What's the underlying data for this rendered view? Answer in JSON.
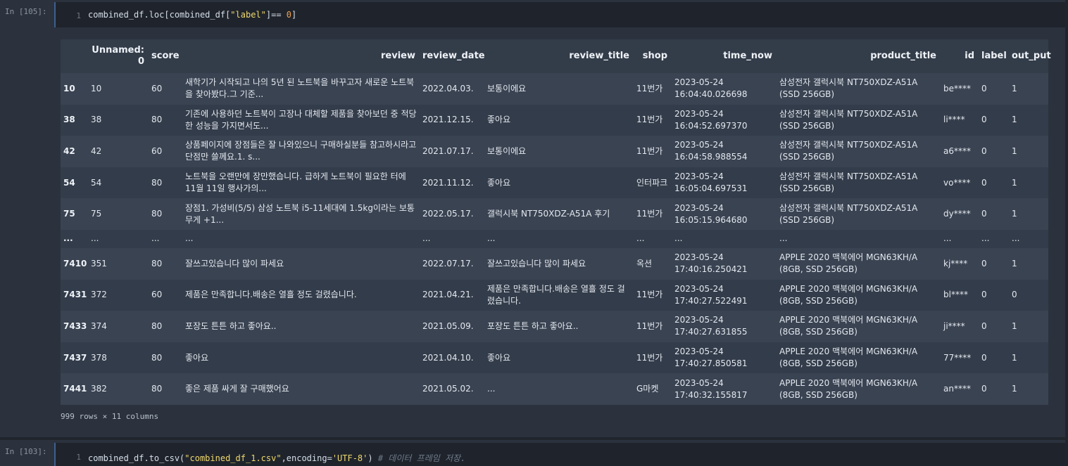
{
  "cell1": {
    "prompt": "In [105]:",
    "line_no": "1",
    "code": {
      "p1": "combined_df.loc[combined_df[",
      "s1": "\"label\"",
      "p2": "]== ",
      "n1": "0",
      "p3": "]"
    }
  },
  "table": {
    "columns": [
      "",
      "Unnamed: 0",
      "score",
      "review",
      "review_date",
      "review_title",
      "shop",
      "time_now",
      "product_title",
      "id",
      "label",
      "out_put"
    ],
    "rows": [
      [
        "10",
        "10",
        "60",
        "새학기가 시작되고 나의 5년 된 노트북을 바꾸고자 새로운 노트북을 찾아봤다.그 기준...",
        "2022.04.03.",
        "보통이에요",
        "11번가",
        "2023-05-24 16:04:40.026698",
        "삼성전자 갤럭시북 NT750XDZ-A51A (SSD 256GB)",
        "be****",
        "0",
        "1"
      ],
      [
        "38",
        "38",
        "80",
        "기존에 사용하던 노트북이 고장나 대체할 제품을 찾아보던 중 적당한 성능을 가지면서도...",
        "2021.12.15.",
        "좋아요",
        "11번가",
        "2023-05-24 16:04:52.697370",
        "삼성전자 갤럭시북 NT750XDZ-A51A (SSD 256GB)",
        "li****",
        "0",
        "1"
      ],
      [
        "42",
        "42",
        "60",
        "상품페이지에 장점들은 잘 나와있으니 구매하실분들 참고하시라고 단점만 쓸께요.1. s...",
        "2021.07.17.",
        "보통이에요",
        "11번가",
        "2023-05-24 16:04:58.988554",
        "삼성전자 갤럭시북 NT750XDZ-A51A (SSD 256GB)",
        "a6****",
        "0",
        "1"
      ],
      [
        "54",
        "54",
        "80",
        "노트북을 오랜만에 장만했습니다. 급하게 노트북이 필요한 터에 11월 11일 행사가의...",
        "2021.11.12.",
        "좋아요",
        "인터파크",
        "2023-05-24 16:05:04.697531",
        "삼성전자 갤럭시북 NT750XDZ-A51A (SSD 256GB)",
        "vo****",
        "0",
        "1"
      ],
      [
        "75",
        "75",
        "80",
        "장점1. 가성비(5/5) 삼성 노트북 i5-11세대에 1.5kg이라는 보통무게 +1...",
        "2022.05.17.",
        "갤럭시북 NT750XDZ-A51A 후기",
        "11번가",
        "2023-05-24 16:05:15.964680",
        "삼성전자 갤럭시북 NT750XDZ-A51A (SSD 256GB)",
        "dy****",
        "0",
        "1"
      ],
      [
        "...",
        "...",
        "...",
        "...",
        "...",
        "...",
        "...",
        "...",
        "...",
        "...",
        "...",
        "..."
      ],
      [
        "7410",
        "351",
        "80",
        "잘쓰고있습니다 많이 파세요",
        "2022.07.17.",
        "잘쓰고있습니다 많이 파세요",
        "옥션",
        "2023-05-24 17:40:16.250421",
        "APPLE 2020 맥북에어 MGN63KH/A (8GB, SSD 256GB)",
        "kj****",
        "0",
        "1"
      ],
      [
        "7431",
        "372",
        "60",
        "제품은 만족합니다.배송은 열흘 정도 걸렸습니다.",
        "2021.04.21.",
        "제품은 만족합니다.배송은 열흘 정도 걸렸습니다.",
        "11번가",
        "2023-05-24 17:40:27.522491",
        "APPLE 2020 맥북에어 MGN63KH/A (8GB, SSD 256GB)",
        "bl****",
        "0",
        "0"
      ],
      [
        "7433",
        "374",
        "80",
        "포장도 튼튼 하고 좋아요..",
        "2021.05.09.",
        "포장도 튼튼 하고 좋아요..",
        "11번가",
        "2023-05-24 17:40:27.631855",
        "APPLE 2020 맥북에어 MGN63KH/A (8GB, SSD 256GB)",
        "ji****",
        "0",
        "1"
      ],
      [
        "7437",
        "378",
        "80",
        "좋아요",
        "2021.04.10.",
        "좋아요",
        "11번가",
        "2023-05-24 17:40:27.850581",
        "APPLE 2020 맥북에어 MGN63KH/A (8GB, SSD 256GB)",
        "77****",
        "0",
        "1"
      ],
      [
        "7441",
        "382",
        "80",
        "좋은 제품 싸게 잘 구매했어요",
        "2021.05.02.",
        "...",
        "G마켓",
        "2023-05-24 17:40:32.155817",
        "APPLE 2020 맥북에어 MGN63KH/A (8GB, SSD 256GB)",
        "an****",
        "0",
        "1"
      ]
    ],
    "summary": "999 rows × 11 columns"
  },
  "cell2": {
    "prompt": "In [103]:",
    "line_no": "1",
    "code": {
      "p1": "combined_df.to_csv(",
      "s1": "\"combined_df_1.csv\"",
      "p2": ",encoding=",
      "s2": "'UTF-8'",
      "p3": ") ",
      "c1": "# 데이터 프레임 저장."
    }
  },
  "colors": {
    "background": "#2b323e",
    "input_bg": "#1f242c",
    "string": "#f0d86d",
    "number": "#f0a050",
    "comment": "#6f7a8a",
    "row_even": "#3a4352",
    "row_odd": "#333c4a"
  }
}
